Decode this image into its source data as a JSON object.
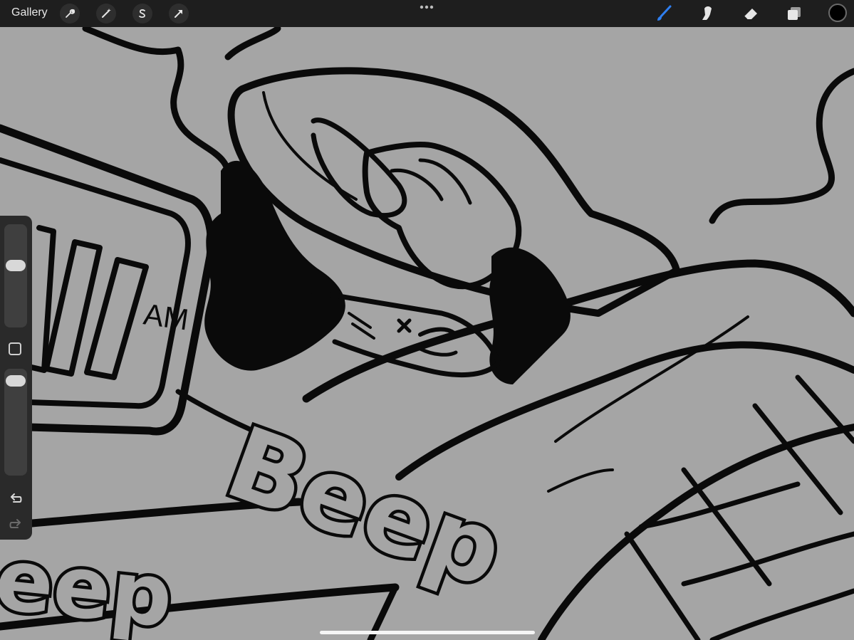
{
  "app": {
    "gallery_label": "Gallery"
  },
  "toolbar": {
    "left_tools": [
      "wrench-icon",
      "magic-wand-icon",
      "selection-s-icon",
      "transform-arrow-icon"
    ],
    "right_tools": [
      "brush-icon",
      "smudge-icon",
      "eraser-icon",
      "layers-icon"
    ],
    "active_tool": "brush-icon",
    "accent_color": "#2f7ff0",
    "current_color": "#000000"
  },
  "sidebar": {
    "brush_size_slider": "brush-size",
    "opacity_slider": "brush-opacity",
    "undo_icon": "undo-icon",
    "redo_icon": "redo-icon"
  },
  "canvas": {
    "background_color": "#a5a5a5",
    "clock_suffix": "AM",
    "sfx_main": "Beep",
    "sfx_left": "eep"
  }
}
